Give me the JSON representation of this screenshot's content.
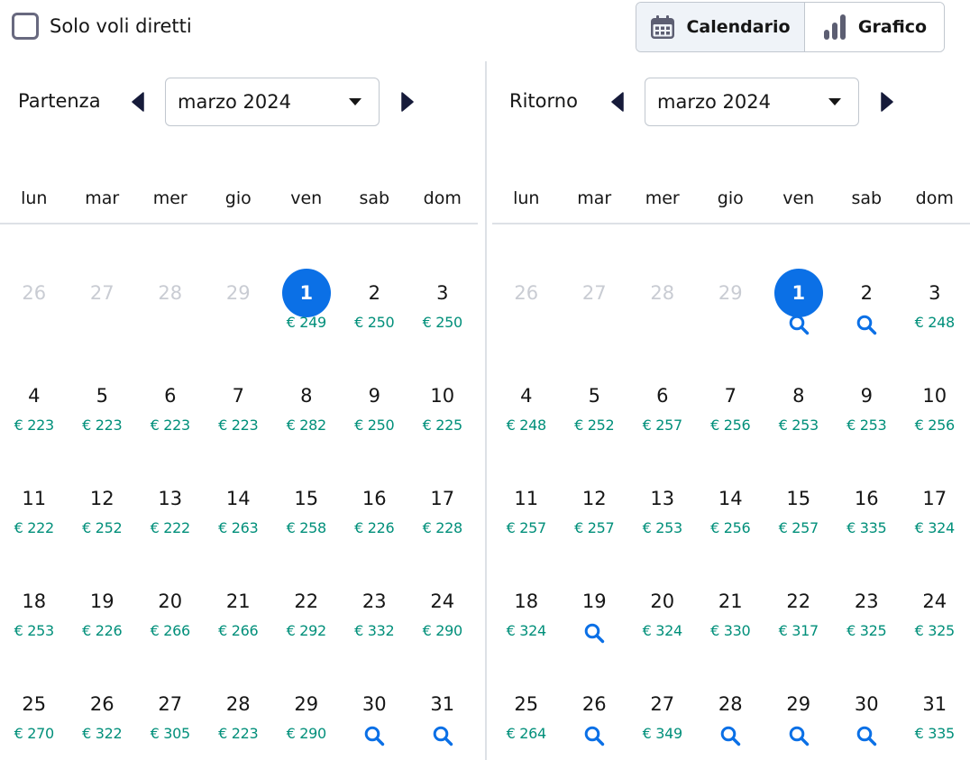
{
  "filters": {
    "direct_only_label": "Solo voli diretti",
    "direct_only_checked": false
  },
  "view_toggle": {
    "calendar_label": "Calendario",
    "chart_label": "Grafico",
    "active": "calendar"
  },
  "departure": {
    "label": "Partenza",
    "month": "marzo 2024",
    "weekdays": [
      "lun",
      "mar",
      "mer",
      "gio",
      "ven",
      "sab",
      "dom"
    ],
    "weeks": [
      [
        {
          "d": "26",
          "muted": true
        },
        {
          "d": "27",
          "muted": true
        },
        {
          "d": "28",
          "muted": true
        },
        {
          "d": "29",
          "muted": true
        },
        {
          "d": "1",
          "p": "€ 249",
          "selected": true
        },
        {
          "d": "2",
          "p": "€ 250"
        },
        {
          "d": "3",
          "p": "€ 250"
        }
      ],
      [
        {
          "d": "4",
          "p": "€ 223"
        },
        {
          "d": "5",
          "p": "€ 223"
        },
        {
          "d": "6",
          "p": "€ 223"
        },
        {
          "d": "7",
          "p": "€ 223"
        },
        {
          "d": "8",
          "p": "€ 282"
        },
        {
          "d": "9",
          "p": "€ 250"
        },
        {
          "d": "10",
          "p": "€ 225"
        }
      ],
      [
        {
          "d": "11",
          "p": "€ 222"
        },
        {
          "d": "12",
          "p": "€ 252"
        },
        {
          "d": "13",
          "p": "€ 222"
        },
        {
          "d": "14",
          "p": "€ 263"
        },
        {
          "d": "15",
          "p": "€ 258"
        },
        {
          "d": "16",
          "p": "€ 226"
        },
        {
          "d": "17",
          "p": "€ 228"
        }
      ],
      [
        {
          "d": "18",
          "p": "€ 253"
        },
        {
          "d": "19",
          "p": "€ 226"
        },
        {
          "d": "20",
          "p": "€ 266"
        },
        {
          "d": "21",
          "p": "€ 266"
        },
        {
          "d": "22",
          "p": "€ 292"
        },
        {
          "d": "23",
          "p": "€ 332"
        },
        {
          "d": "24",
          "p": "€ 290"
        }
      ],
      [
        {
          "d": "25",
          "p": "€ 270"
        },
        {
          "d": "26",
          "p": "€ 322"
        },
        {
          "d": "27",
          "p": "€ 305"
        },
        {
          "d": "28",
          "p": "€ 223"
        },
        {
          "d": "29",
          "p": "€ 290"
        },
        {
          "d": "30",
          "search": true
        },
        {
          "d": "31",
          "search": true
        }
      ]
    ]
  },
  "return": {
    "label": "Ritorno",
    "month": "marzo 2024",
    "weekdays": [
      "lun",
      "mar",
      "mer",
      "gio",
      "ven",
      "sab",
      "dom"
    ],
    "weeks": [
      [
        {
          "d": "26",
          "muted": true
        },
        {
          "d": "27",
          "muted": true
        },
        {
          "d": "28",
          "muted": true
        },
        {
          "d": "29",
          "muted": true
        },
        {
          "d": "1",
          "search": true,
          "selected": true
        },
        {
          "d": "2",
          "search": true
        },
        {
          "d": "3",
          "p": "€ 248"
        }
      ],
      [
        {
          "d": "4",
          "p": "€ 248"
        },
        {
          "d": "5",
          "p": "€ 252"
        },
        {
          "d": "6",
          "p": "€ 257"
        },
        {
          "d": "7",
          "p": "€ 256"
        },
        {
          "d": "8",
          "p": "€ 253"
        },
        {
          "d": "9",
          "p": "€ 253"
        },
        {
          "d": "10",
          "p": "€ 256"
        }
      ],
      [
        {
          "d": "11",
          "p": "€ 257"
        },
        {
          "d": "12",
          "p": "€ 257"
        },
        {
          "d": "13",
          "p": "€ 253"
        },
        {
          "d": "14",
          "p": "€ 256"
        },
        {
          "d": "15",
          "p": "€ 257"
        },
        {
          "d": "16",
          "p": "€ 335"
        },
        {
          "d": "17",
          "p": "€ 324"
        }
      ],
      [
        {
          "d": "18",
          "p": "€ 324"
        },
        {
          "d": "19",
          "search": true
        },
        {
          "d": "20",
          "p": "€ 324"
        },
        {
          "d": "21",
          "p": "€ 330"
        },
        {
          "d": "22",
          "p": "€ 317"
        },
        {
          "d": "23",
          "p": "€ 325"
        },
        {
          "d": "24",
          "p": "€ 325"
        }
      ],
      [
        {
          "d": "25",
          "p": "€ 264"
        },
        {
          "d": "26",
          "search": true
        },
        {
          "d": "27",
          "p": "€ 349"
        },
        {
          "d": "28",
          "search": true
        },
        {
          "d": "29",
          "search": true
        },
        {
          "d": "30",
          "search": true
        },
        {
          "d": "31",
          "p": "€ 335"
        }
      ]
    ]
  },
  "colors": {
    "accent": "#0b70e6",
    "price": "#008f7a",
    "muted": "#c9ccd3",
    "text": "#161616"
  },
  "icons": {
    "search": "search-icon",
    "calendar": "calendar-icon",
    "chart": "bar-chart-icon",
    "prev": "caret-left-icon",
    "next": "caret-right-icon"
  }
}
